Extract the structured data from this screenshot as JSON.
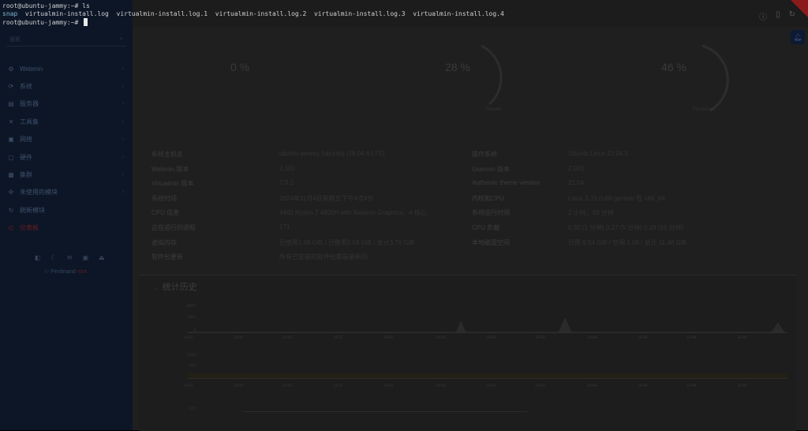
{
  "terminal": {
    "line1_prompt": "root@ubuntu-jammy:~# ls",
    "line2_items": [
      "snap",
      "virtualmin-install.log",
      "virtualmin-install.log.1",
      "virtualmin-install.log.2",
      "virtualmin-install.log.3",
      "virtualmin-install.log.4"
    ],
    "line3_prompt": "root@ubuntu-jammy:~#"
  },
  "sidebar": {
    "search_placeholder": "搜索",
    "items": [
      {
        "label": "Webmin",
        "icon": "gear-icon"
      },
      {
        "label": "系统",
        "icon": "refresh-icon"
      },
      {
        "label": "服务器",
        "icon": "server-icon"
      },
      {
        "label": "工具集",
        "icon": "wrench-icon"
      },
      {
        "label": "网络",
        "icon": "network-icon"
      },
      {
        "label": "硬件",
        "icon": "hardware-icon"
      },
      {
        "label": "集群",
        "icon": "cluster-icon"
      },
      {
        "label": "未使用的模块",
        "icon": "puzzle-icon"
      },
      {
        "label": "刷新模块",
        "icon": "reload-icon"
      },
      {
        "label": "仪表板",
        "icon": "dashboard-icon"
      }
    ],
    "user_name": "Ferdinand",
    "user_tag": "root"
  },
  "gauges": [
    {
      "value": "0 %",
      "label": ""
    },
    {
      "value": "28 %",
      "label": "Reader"
    },
    {
      "value": "46 %",
      "label": "Processes"
    }
  ],
  "info_left": {
    "labels": [
      "系统主机名",
      "Webmin 版本",
      "Virtualmin 版本",
      "系统时间",
      "CPU 信息",
      "正在运行的进程",
      "虚拟内存",
      "软件包更新"
    ],
    "values": [
      "ubuntu-jammy (ubuntu) (18.04.6 LTS)",
      "2.101",
      "7.3.2",
      "2024年11月4日星期五下午4点4分",
      "AMD Ryzen 7 4800H with Radeon Graphics，4 核心",
      "171",
      "已使用1.06 GiB / 已使用2.04 GiB / 总计3.76 GiB",
      "所有已安装的软件包都是最新的"
    ]
  },
  "info_right": {
    "labels": [
      "操作系统",
      "Usermin 版本",
      "Authentic theme version",
      "内核和CPU",
      "系统运行时间",
      "CPU 负载",
      "本地磁盘空间"
    ],
    "values": [
      "Ubuntu Linux 22.04.5",
      "2.001",
      "21.04",
      "Linux 5.15.0-88-generic 在 x86_64",
      "2 小时，33 分钟",
      "0.30 (1 分钟) 0.27 (5 分钟) 0.19 (15 分钟)",
      "已用 9.54 GiB / 空闲 1.09 / 总计 11.48 GiB"
    ]
  },
  "history": {
    "title": "统计历史",
    "x_ticks": [
      "14:41",
      "14:41",
      "14:42",
      "14:42",
      "14:42",
      "14:43",
      "14:43",
      "14:43",
      "14:44",
      "14:44",
      "14:44",
      "14:45"
    ],
    "chart1_y": [
      "100%",
      "50%",
      "0"
    ],
    "chart2_y": [
      "1000",
      "500",
      "0"
    ],
    "chart3_y": [
      "100"
    ]
  }
}
